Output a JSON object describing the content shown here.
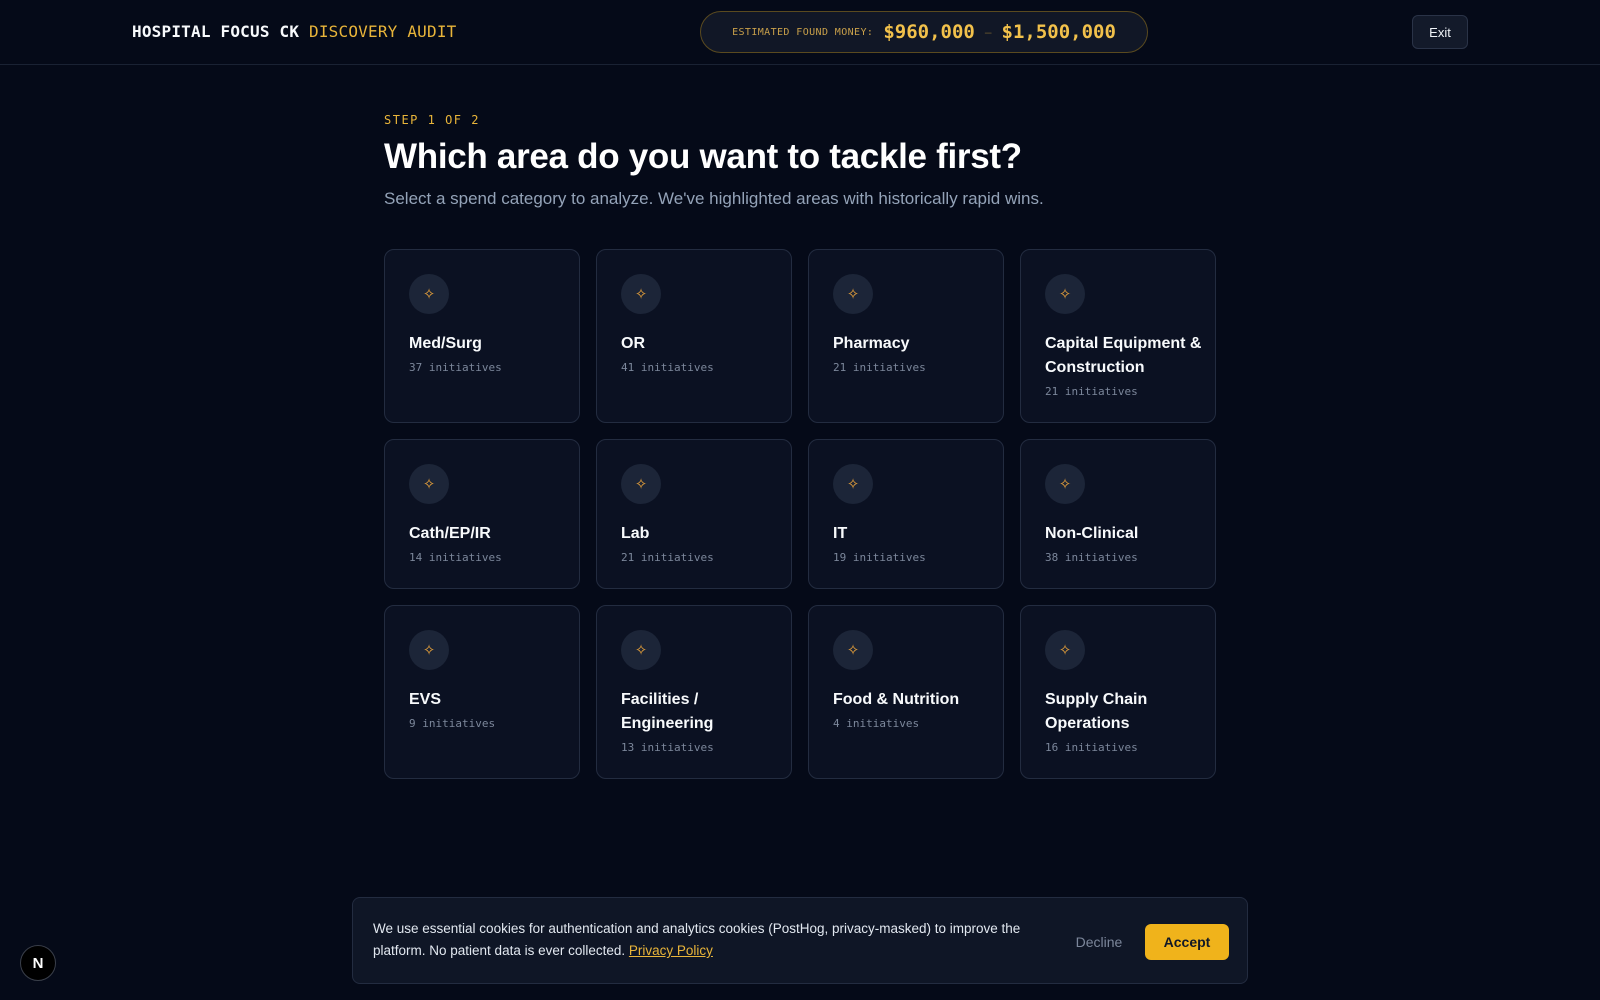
{
  "header": {
    "brand_primary": "HOSPITAL FOCUS CK",
    "brand_secondary": "DISCOVERY AUDIT",
    "money_label": "ESTIMATED FOUND MONEY:",
    "money_low": "$960,000",
    "money_separator": "–",
    "money_high": "$1,500,000",
    "exit_label": "Exit"
  },
  "main": {
    "step": "STEP 1 OF 2",
    "title": "Which area do you want to tackle first?",
    "subtitle": "Select a spend category to analyze. We've highlighted areas with historically rapid wins."
  },
  "categories": [
    {
      "name": "Med/Surg",
      "count": "37 initiatives",
      "icon": "sparkle-icon"
    },
    {
      "name": "OR",
      "count": "41 initiatives",
      "icon": "sparkle-icon"
    },
    {
      "name": "Pharmacy",
      "count": "21 initiatives",
      "icon": "sparkle-icon"
    },
    {
      "name": "Capital Equipment & Construction",
      "count": "21 initiatives",
      "icon": "sparkle-icon"
    },
    {
      "name": "Cath/EP/IR",
      "count": "14 initiatives",
      "icon": "sparkle-icon"
    },
    {
      "name": "Lab",
      "count": "21 initiatives",
      "icon": "sparkle-icon"
    },
    {
      "name": "IT",
      "count": "19 initiatives",
      "icon": "sparkle-icon"
    },
    {
      "name": "Non-Clinical",
      "count": "38 initiatives",
      "icon": "sparkle-icon"
    },
    {
      "name": "EVS",
      "count": "9 initiatives",
      "icon": "sparkle-icon"
    },
    {
      "name": "Facilities / Engineering",
      "count": "13 initiatives",
      "icon": "sparkle-icon"
    },
    {
      "name": "Food & Nutrition",
      "count": "4 initiatives",
      "icon": "sparkle-icon"
    },
    {
      "name": "Supply Chain Operations",
      "count": "16 initiatives",
      "icon": "sparkle-icon"
    }
  ],
  "cookie_banner": {
    "text": "We use essential cookies for authentication and analytics cookies (PostHog, privacy-masked) to improve the platform. No patient data is ever collected.",
    "policy_link": "Privacy Policy",
    "decline_label": "Decline",
    "accept_label": "Accept"
  },
  "dev_badge": "N",
  "colors": {
    "background": "#050a18",
    "accent": "#e9b53a",
    "accept_button": "#f0b31b",
    "card": "#0b1122"
  }
}
